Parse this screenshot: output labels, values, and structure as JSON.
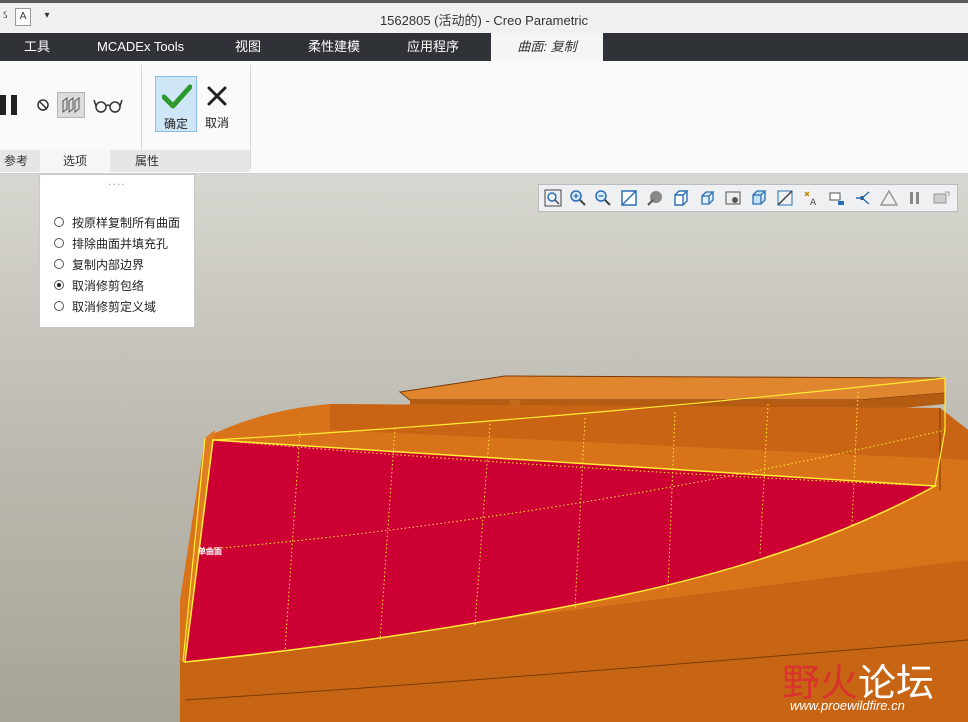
{
  "window": {
    "title": "1562805 (活动的) - Creo Parametric",
    "quick_access": [
      "A"
    ]
  },
  "menu": {
    "items": [
      "工具",
      "MCADEx Tools",
      "视图",
      "柔性建模",
      "应用程序"
    ],
    "active_tab": "曲面: 复制"
  },
  "ribbon": {
    "ok_label": "确定",
    "cancel_label": "取消",
    "tabs": [
      "参考",
      "选项",
      "属性"
    ],
    "active_tab_index": 1
  },
  "options_panel": {
    "grip": "....",
    "options": [
      {
        "label": "按原样复制所有曲面",
        "checked": false
      },
      {
        "label": "排除曲面并填充孔",
        "checked": false
      },
      {
        "label": "复制内部边界",
        "checked": false
      },
      {
        "label": "取消修剪包络",
        "checked": true
      },
      {
        "label": "取消修剪定义域",
        "checked": false
      }
    ]
  },
  "view_toolbar": {
    "icons": [
      "refit-icon",
      "zoom-in-icon",
      "zoom-out-icon",
      "repaint-icon",
      "display-style-icon",
      "named-views-icon",
      "saved-orientations-icon",
      "perspective-icon",
      "section-icon",
      "datum-display-icon",
      "annotation-icon",
      "spin-center-icon",
      "axis-icon",
      "warning-icon",
      "pause-icon",
      "next-icon"
    ]
  },
  "model": {
    "surface_label": "单曲面"
  },
  "watermark": {
    "part1": "野火",
    "part2": "论坛",
    "url": "www.proewildfire.cn"
  },
  "colors": {
    "menu_bg": "#2f3337",
    "model_orange": "#d9731a",
    "selected_surface": "#cc0033",
    "edge_yellow": "#ffee33",
    "ok_highlight": "#cfe6f7"
  }
}
